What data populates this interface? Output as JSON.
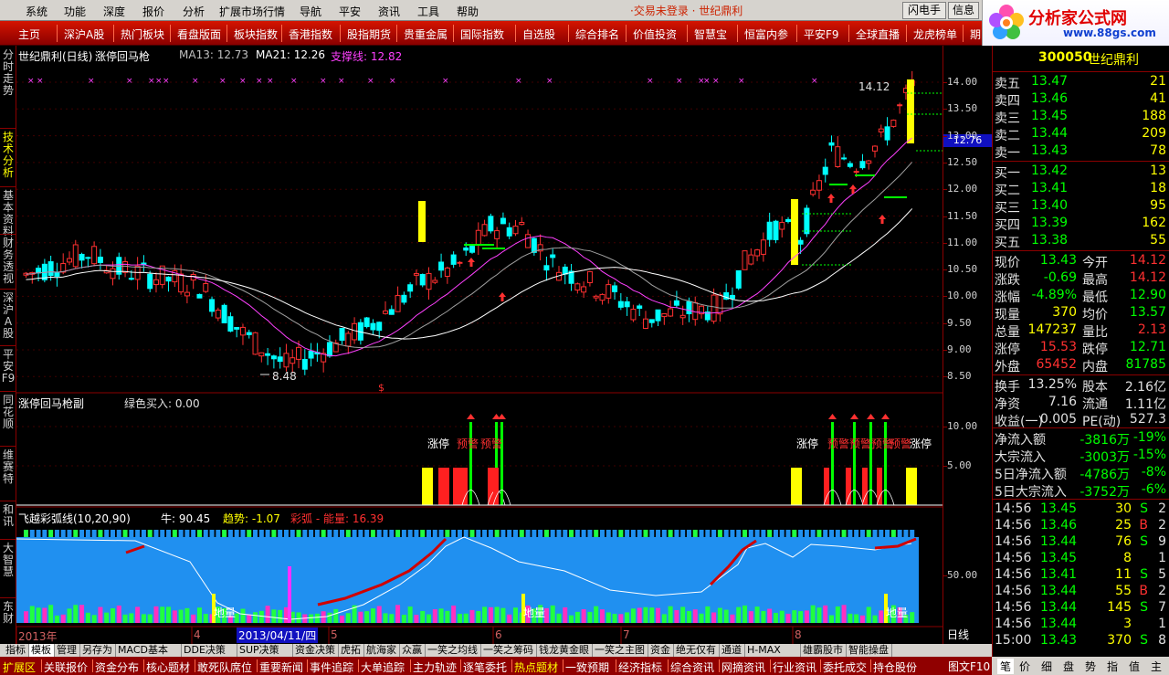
{
  "menu": {
    "items": [
      "系统",
      "功能",
      "深度",
      "报价",
      "分析",
      "扩展市场行情",
      "导航",
      "平安",
      "资讯",
      "工具",
      "帮助"
    ],
    "ticker": "·交易未登录 · 世纪鼎利",
    "btn_flash": "闪电手",
    "btn_info": "信息"
  },
  "logo": {
    "title": "分析家公式网",
    "url": "www.88gs.com"
  },
  "toolbar": [
    "主页",
    "深沪A股",
    "热门板块",
    "看盘版面",
    "板块指数",
    "香港指数",
    "股指期货",
    "贵重金属",
    "国际指数",
    "自选股",
    "综合排名",
    "价值投资",
    "智慧宝",
    "恒富内参",
    "平安F9",
    "全球直播",
    "龙虎榜单",
    "期"
  ],
  "left_tabs": [
    "分时走势",
    "技术分析",
    "基本资料",
    "财务透视",
    "深沪A股",
    "平安F9",
    "同花顺",
    "维赛特",
    "和讯",
    "大智慧",
    "东财"
  ],
  "main_header": {
    "stock": "世纪鼎利(日线)",
    "formula": "涨停回马枪",
    "ma13_label": "MA13: 12.73",
    "ma21_label": "MA21: 12.26",
    "support_label": "支撑线: 12.82",
    "high_mark": "14.12",
    "low_mark": "8.48",
    "current_price_tag": "12.76"
  },
  "sub1_header": {
    "title": "涨停回马枪副",
    "green_buy": "绿色买入: 0.00"
  },
  "sub1_labels": {
    "limit_up": "涨停",
    "alert": "预警"
  },
  "sub2_header": {
    "title": "飞越彩弧线(10,20,90)",
    "bull": "牛: 90.45",
    "trend": "趋势: -1.07",
    "arc": "彩弧 - 能量: 16.39"
  },
  "sub2_labels": {
    "volume": "地量"
  },
  "price_axis": [
    "14.00",
    "13.50",
    "13.00",
    "12.50",
    "12.00",
    "11.50",
    "11.00",
    "10.50",
    "10.00",
    "9.50",
    "9.00",
    "8.50"
  ],
  "sub1_axis": [
    "10.00",
    "5.00"
  ],
  "sub2_axis": [
    "50.00"
  ],
  "date_axis": {
    "year": "2013年",
    "m4": "4",
    "selected_date": "2013/04/11/四",
    "m5": "5",
    "m6": "6",
    "m7": "7",
    "m8": "8",
    "period": "日线"
  },
  "quote": {
    "code": "300050",
    "name": "世纪鼎利",
    "asks": [
      {
        "label": "卖五",
        "price": "13.47",
        "vol": "21"
      },
      {
        "label": "卖四",
        "price": "13.46",
        "vol": "41"
      },
      {
        "label": "卖三",
        "price": "13.45",
        "vol": "188"
      },
      {
        "label": "卖二",
        "price": "13.44",
        "vol": "209"
      },
      {
        "label": "卖一",
        "price": "13.43",
        "vol": "78"
      }
    ],
    "bids": [
      {
        "label": "买一",
        "price": "13.42",
        "vol": "13"
      },
      {
        "label": "买二",
        "price": "13.41",
        "vol": "18"
      },
      {
        "label": "买三",
        "price": "13.40",
        "vol": "95"
      },
      {
        "label": "买四",
        "price": "13.39",
        "vol": "162"
      },
      {
        "label": "买五",
        "price": "13.38",
        "vol": "55"
      }
    ],
    "stats": [
      {
        "l1": "现价",
        "v1": "13.43",
        "l2": "今开",
        "v2": "14.12"
      },
      {
        "l1": "涨跌",
        "v1": "-0.69",
        "l2": "最高",
        "v2": "14.12"
      },
      {
        "l1": "涨幅",
        "v1": "-4.89%",
        "l2": "最低",
        "v2": "12.90"
      },
      {
        "l1": "现量",
        "v1": "370",
        "l2": "均价",
        "v2": "13.57"
      },
      {
        "l1": "总量",
        "v1": "147237",
        "l2": "量比",
        "v2": "2.13"
      },
      {
        "l1": "涨停",
        "v1": "15.53",
        "l2": "跌停",
        "v2": "12.71"
      },
      {
        "l1": "外盘",
        "v1": "65452",
        "l2": "内盘",
        "v2": "81785"
      }
    ],
    "stats2": [
      {
        "l1": "换手",
        "v1": "13.25%",
        "l2": "股本",
        "v2": "2.16亿"
      },
      {
        "l1": "净资",
        "v1": "7.16",
        "l2": "流通",
        "v2": "1.11亿"
      },
      {
        "l1": "收益(一)",
        "v1": "0.005",
        "l2": "PE(动)",
        "v2": "527.3"
      }
    ],
    "flows": [
      {
        "l": "净流入额",
        "v": "-3816万",
        "p": "-19%"
      },
      {
        "l": "大宗流入",
        "v": "-3003万",
        "p": "-15%"
      },
      {
        "l": "5日净流入额",
        "v": "-4786万",
        "p": "-8%"
      },
      {
        "l": "5日大宗流入",
        "v": "-3752万",
        "p": "-6%"
      }
    ],
    "ticks": [
      {
        "t": "14:56",
        "p": "13.45",
        "v": "30",
        "d": "S",
        "n": "2"
      },
      {
        "t": "14:56",
        "p": "13.46",
        "v": "25",
        "d": "B",
        "n": "2"
      },
      {
        "t": "14:56",
        "p": "13.44",
        "v": "76",
        "d": "S",
        "n": "9"
      },
      {
        "t": "14:56",
        "p": "13.45",
        "v": "8",
        "d": "",
        "n": "1"
      },
      {
        "t": "14:56",
        "p": "13.41",
        "v": "11",
        "d": "S",
        "n": "5"
      },
      {
        "t": "14:56",
        "p": "13.44",
        "v": "55",
        "d": "B",
        "n": "2"
      },
      {
        "t": "14:56",
        "p": "13.44",
        "v": "145",
        "d": "S",
        "n": "7"
      },
      {
        "t": "14:56",
        "p": "13.44",
        "v": "3",
        "d": "",
        "n": "1"
      },
      {
        "t": "15:00",
        "p": "13.43",
        "v": "370",
        "d": "S",
        "n": "8"
      }
    ]
  },
  "bottom_tabs": [
    "指标",
    "模板",
    "管理",
    "另存为",
    "MACD基本",
    "DDE决策",
    "SUP决策",
    "资金决策",
    "虎拓",
    "航海家",
    "众赢",
    "一笑之均线",
    "一笑之筹码",
    "钱龙黄金眼",
    "一笑之主图",
    "资金",
    "绝无仅有",
    "通道",
    "H-MAX",
    "雄霸股市",
    "智能操盘"
  ],
  "bottom_bar": [
    "扩展区",
    "关联报价",
    "资金分布",
    "核心题材",
    "敢死队席位",
    "重要新闻",
    "事件追踪",
    "大单追踪",
    "主力轨迹",
    "逐笔委托",
    "热点题材",
    "一致预期",
    "经济指标",
    "综合资讯",
    "网摘资讯",
    "行业资讯",
    "委托成交",
    "持仓股份"
  ],
  "right_tabs": [
    "笔",
    "价",
    "细",
    "盘",
    "势",
    "指",
    "值",
    "主"
  ],
  "right_bar_label": "图文F10",
  "colors": {
    "up": "#ff3030",
    "down": "#00ffff",
    "accent": "#ffff00",
    "ma13": "#ff40ff",
    "ma21": "#ffffff",
    "sub2_bg": "#2090f0"
  }
}
